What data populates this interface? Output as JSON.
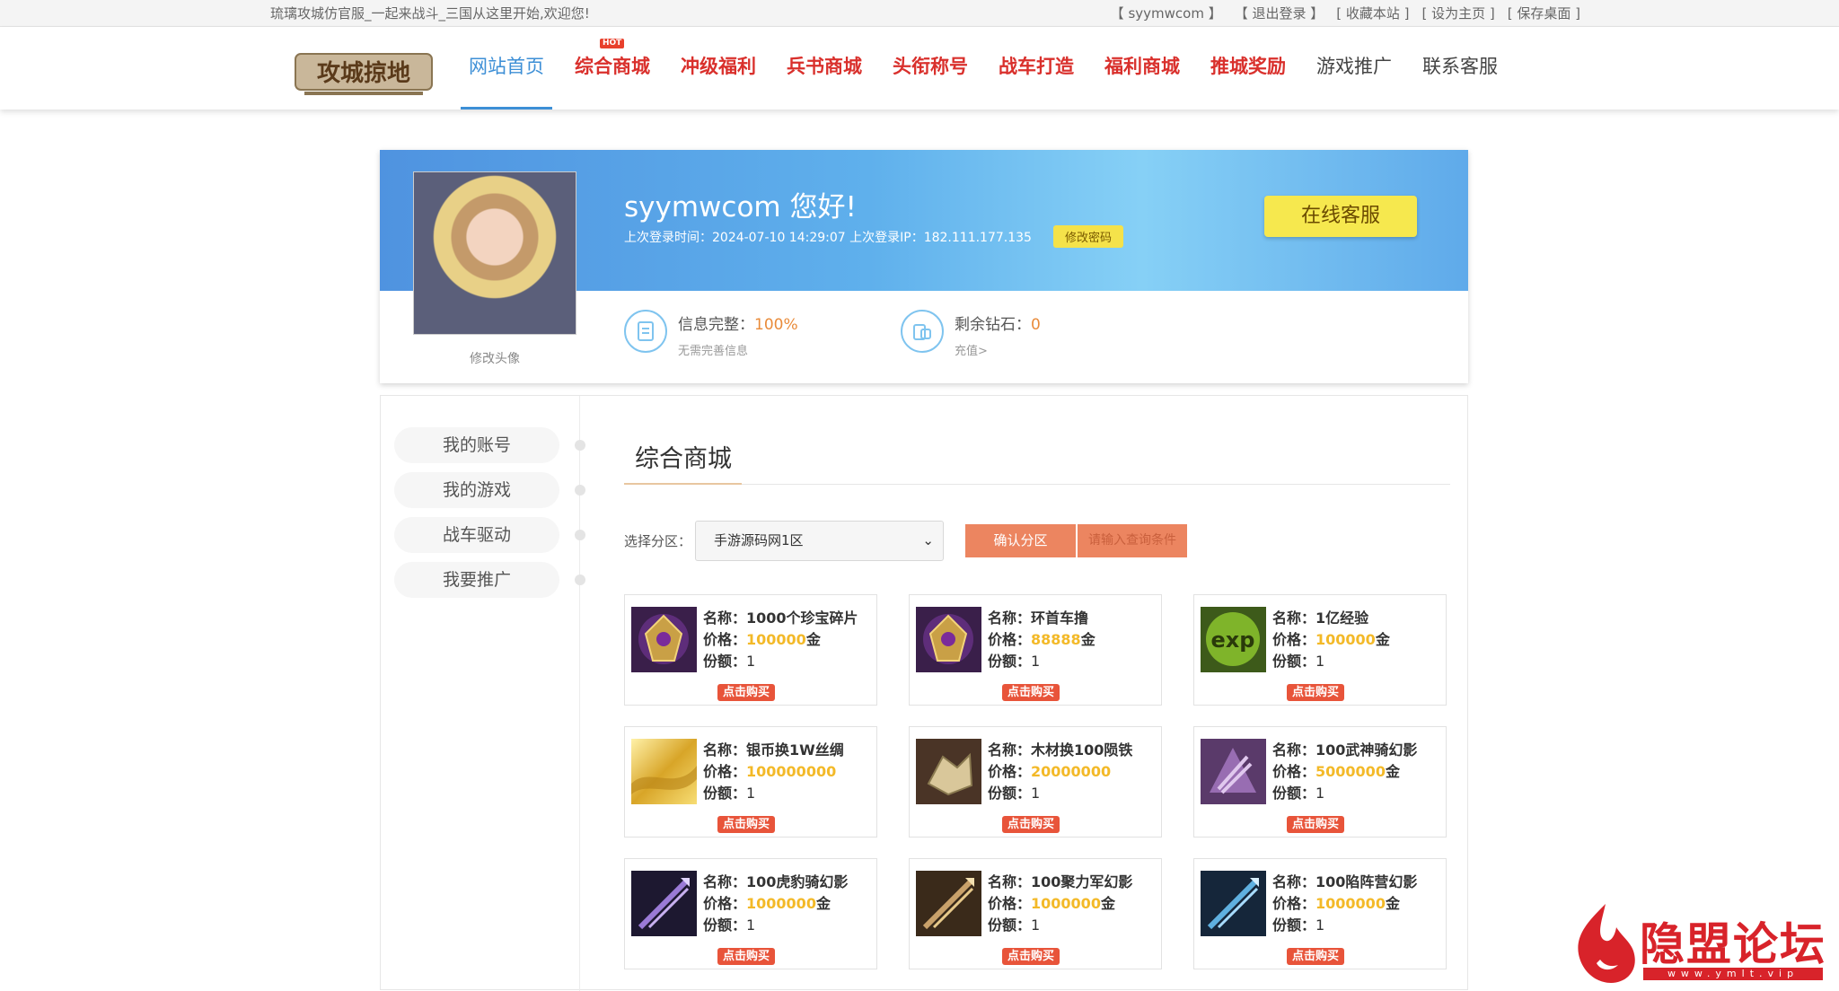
{
  "topbar": {
    "welcome": "琉璃攻城仿官服_一起来战斗_三国从这里开始,欢迎您!",
    "links": [
      "【 syymwcom 】",
      "【 退出登录 】",
      "[ 收藏本站 ]",
      "[ 设为主页 ]",
      "[ 保存桌面 ]"
    ]
  },
  "nav": {
    "logo_text": "攻城掠地",
    "items": [
      {
        "label": "网站首页",
        "state": "active"
      },
      {
        "label": "综合商城",
        "badge": "HOT"
      },
      {
        "label": "冲级福利"
      },
      {
        "label": "兵书商城"
      },
      {
        "label": "头衔称号"
      },
      {
        "label": "战车打造"
      },
      {
        "label": "福利商城"
      },
      {
        "label": "推城奖励"
      },
      {
        "label": "游戏推广",
        "state": "plain"
      },
      {
        "label": "联系客服",
        "state": "plain"
      }
    ]
  },
  "profile": {
    "greeting": "syymwcom 您好!",
    "last_login": "上次登录时间：2024-07-10 14:29:07 上次登录IP：182.111.177.135",
    "change_pwd": "修改密码",
    "online_service": "在线客服",
    "avatar_caption": "修改头像",
    "info_label": "信息完整：",
    "info_value": "100%",
    "info_sub": "无需完善信息",
    "diamond_label": "剩余钻石：",
    "diamond_value": "0",
    "diamond_sub": "充值>"
  },
  "sidebar": {
    "items": [
      "我的账号",
      "我的游戏",
      "战车驱动",
      "我要推广"
    ]
  },
  "mall": {
    "title": "综合商城",
    "zone_label": "选择分区：",
    "zone_selected": "手游源码网1区",
    "confirm_btn": "确认分区",
    "query_btn": "请输入查询条件",
    "name_label": "名称：",
    "price_label": "价格：",
    "quota_label": "份额：",
    "buy_label": "点击购买",
    "products": [
      {
        "name": "1000个珍宝碎片",
        "price": "100000",
        "unit": "金",
        "quota": "1",
        "thumb": "purple-gold-crest"
      },
      {
        "name": "环首车撸",
        "price": "88888",
        "unit": "金",
        "quota": "1",
        "thumb": "purple-gold-crest"
      },
      {
        "name": "1亿经验",
        "price": "100000",
        "unit": "金",
        "quota": "1",
        "thumb": "exp-green"
      },
      {
        "name": "银币换1W丝绸",
        "price": "100000000",
        "unit": "",
        "quota": "1",
        "thumb": "gold-silk"
      },
      {
        "name": "木材换100陨铁",
        "price": "20000000",
        "unit": "",
        "quota": "1",
        "thumb": "ore-crystal"
      },
      {
        "name": "100武神骑幻影",
        "price": "5000000",
        "unit": "金",
        "quota": "1",
        "thumb": "purple-rider"
      },
      {
        "name": "100虎豹骑幻影",
        "price": "1000000",
        "unit": "金",
        "quota": "1",
        "thumb": "purple-spear"
      },
      {
        "name": "100聚力军幻影",
        "price": "1000000",
        "unit": "金",
        "quota": "1",
        "thumb": "brown-spear"
      },
      {
        "name": "100陷阵营幻影",
        "price": "1000000",
        "unit": "金",
        "quota": "1",
        "thumb": "blue-spear"
      }
    ]
  },
  "watermark": {
    "title": "隐盟论坛",
    "sub": "www.ymlt.vip"
  },
  "colors": {
    "nav_red": "#d9302c",
    "nav_active": "#3d8fd6",
    "price_gold": "#f3b928",
    "button_orange": "#ec8560",
    "banner_blue": "#5fb0ec"
  }
}
